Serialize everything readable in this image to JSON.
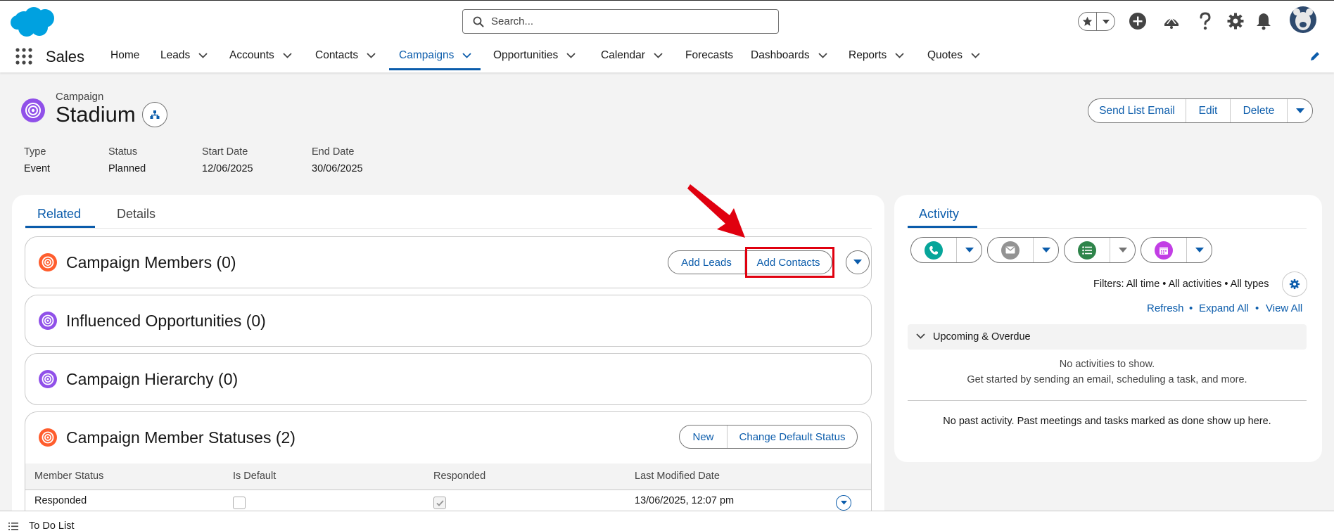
{
  "colors": {
    "brand_blue": "#0b5cab",
    "logo_blue": "#00a1e0",
    "campaign_purple": "#9050e9",
    "campaign_orange": "#ff5d2d",
    "call_green": "#06a59a",
    "task_green": "#2e844a",
    "event_purple": "#c23ee5",
    "email_gray": "#939393",
    "highlight_red": "#e0000f"
  },
  "header": {
    "logo_icon": "cloud-logo-icon",
    "search_placeholder": "Search..."
  },
  "nav": {
    "app_name": "Sales",
    "items": [
      {
        "label": "Home"
      },
      {
        "label": "Leads"
      },
      {
        "label": "Accounts"
      },
      {
        "label": "Contacts"
      },
      {
        "label": "Campaigns",
        "active": true
      },
      {
        "label": "Opportunities"
      },
      {
        "label": "Calendar"
      },
      {
        "label": "Forecasts"
      },
      {
        "label": "Dashboards"
      },
      {
        "label": "Reports"
      },
      {
        "label": "Quotes"
      }
    ]
  },
  "record": {
    "object_label": "Campaign",
    "title": "Stadium",
    "actions": [
      "Send List Email",
      "Edit",
      "Delete"
    ],
    "fields": [
      {
        "label": "Type",
        "value": "Event"
      },
      {
        "label": "Status",
        "value": "Planned"
      },
      {
        "label": "Start Date",
        "value": "12/06/2025"
      },
      {
        "label": "End Date",
        "value": "30/06/2025"
      }
    ]
  },
  "tabs": {
    "related": "Related",
    "details": "Details"
  },
  "related": {
    "members": {
      "title": "Campaign Members (0)",
      "add_leads": "Add Leads",
      "add_contacts": "Add Contacts"
    },
    "influenced": {
      "title": "Influenced Opportunities (0)"
    },
    "hierarchy": {
      "title": "Campaign Hierarchy (0)"
    },
    "statuses": {
      "title": "Campaign Member Statuses (2)",
      "new": "New",
      "change_default": "Change Default Status",
      "columns": [
        "Member Status",
        "Is Default",
        "Responded",
        "Last Modified Date"
      ],
      "rows": [
        {
          "status": "Responded",
          "is_default": false,
          "responded": true,
          "modified": "13/06/2025, 12:07 pm"
        }
      ]
    }
  },
  "activity": {
    "tab": "Activity",
    "filters": "Filters: All time • All activities • All types",
    "links": [
      "Refresh",
      "Expand All",
      "View All"
    ],
    "upcoming": "Upcoming & Overdue",
    "no_activities": "No activities to show.",
    "get_started": "Get started by sending an email, scheduling a task, and more.",
    "no_past": "No past activity. Past meetings and tasks marked as done show up here."
  },
  "footer": {
    "todo": "To Do List"
  }
}
